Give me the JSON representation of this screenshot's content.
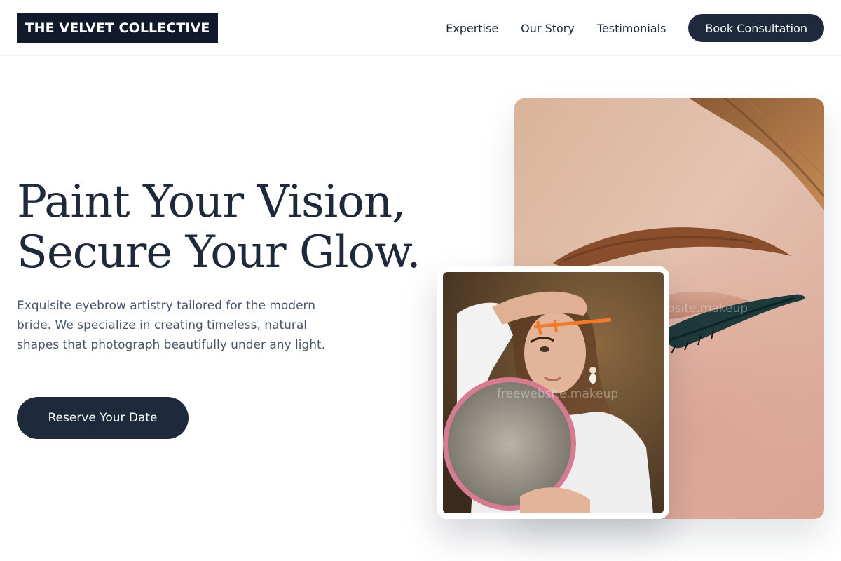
{
  "header": {
    "logo": "THE VELVET COLLECTIVE",
    "nav": [
      "Expertise",
      "Our Story",
      "Testimonials"
    ],
    "cta": "Book Consultation"
  },
  "hero": {
    "headline_line1": "Paint Your Vision,",
    "headline_line2": "Secure Your Glow.",
    "lead": "Exquisite eyebrow artistry tailored for the modern bride. We specialize in creating timeless, natural shapes that photograph beautifully under any light.",
    "cta": "Reserve Your Date"
  },
  "images": {
    "watermark_main": "freewebsite.makeup",
    "watermark_inset": "freewebsite.makeup"
  },
  "colors": {
    "primary": "#1e293b",
    "logo_bg": "#111a2c",
    "body_text": "#475569"
  }
}
